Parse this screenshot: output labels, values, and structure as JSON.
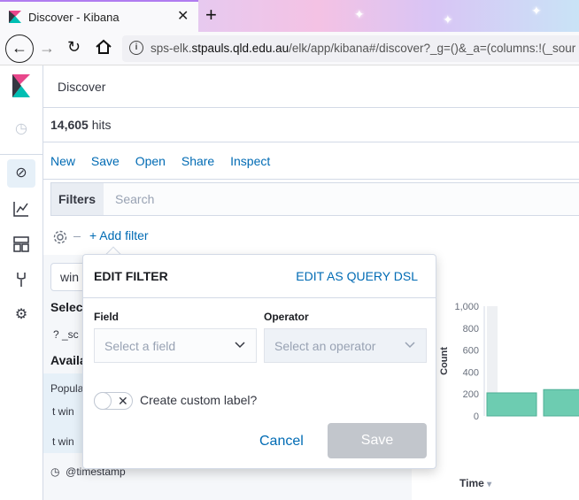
{
  "browser": {
    "tab_title": "Discover - Kibana",
    "url_prefix": "sps-elk.",
    "url_domain": "stpauls.qld.edu.au",
    "url_rest": "/elk/app/kibana#/discover?_g=()&_a=(columns:!(_sour"
  },
  "kibana": {
    "page_title": "Discover",
    "hits_count": "14,605",
    "hits_label": " hits",
    "menu": [
      "New",
      "Save",
      "Open",
      "Share",
      "Inspect"
    ],
    "filters_label": "Filters",
    "search_placeholder": "Search",
    "add_filter": "+ Add filter",
    "index_pattern": "win",
    "selected_title": "Selec",
    "selected_item": "?   _sc",
    "available_title": "Availa",
    "popular_title": "Popula",
    "popular_fields": [
      "t   win",
      "t   win"
    ],
    "timestamp_field": "@timestamp",
    "time_column": "Time",
    "sort_icon": "▾"
  },
  "chart_data": {
    "type": "bar",
    "ylabel": "Count",
    "y_ticks": [
      "1,000",
      "800",
      "600",
      "400",
      "200",
      "0"
    ],
    "ylim": [
      0,
      1000
    ],
    "values": [
      210,
      240
    ],
    "bar_color": "#6dccb1"
  },
  "filter_popover": {
    "title": "EDIT FILTER",
    "dsl_link": "EDIT AS QUERY DSL",
    "field_label": "Field",
    "field_placeholder": "Select a field",
    "operator_label": "Operator",
    "operator_placeholder": "Select an operator",
    "custom_label_toggle": "Create custom label?",
    "cancel": "Cancel",
    "save": "Save"
  },
  "colors": {
    "link": "#006bb4",
    "save_disabled": "#c2c6cc"
  }
}
